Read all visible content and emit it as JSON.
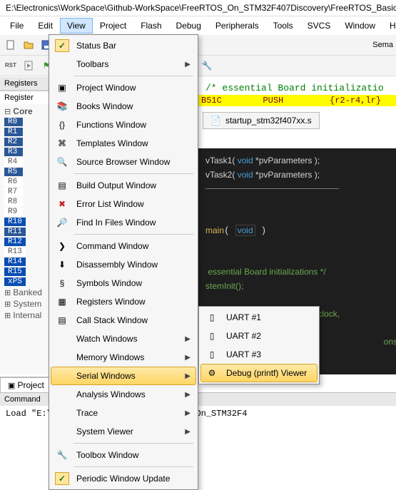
{
  "window_title": "E:\\Electronics\\WorkSpace\\Github-WorkSpace\\FreeRTOS_On_STM32F407Discovery\\FreeRTOS_Basic_Setup",
  "menubar": [
    "File",
    "Edit",
    "View",
    "Project",
    "Flash",
    "Debug",
    "Peripherals",
    "Tools",
    "SVCS",
    "Window",
    "Help"
  ],
  "sema_label": "Sema",
  "registers": {
    "panel_title": "Registers",
    "tab": "Register",
    "core_label": "Core",
    "regs": [
      "R0",
      "R1",
      "R2",
      "R3",
      "R4",
      "R5",
      "R6",
      "R7",
      "R8",
      "R9",
      "R10",
      "R11",
      "R12",
      "R13",
      "R14",
      "R15",
      "xPS"
    ],
    "groups": [
      "Banked",
      "System",
      "Internal"
    ],
    "project_tab": "Project"
  },
  "view_menu": {
    "status_bar": "Status Bar",
    "toolbars": "Toolbars",
    "project_window": "Project Window",
    "books_window": "Books Window",
    "functions_window": "Functions Window",
    "templates_window": "Templates Window",
    "source_browser_window": "Source Browser Window",
    "build_output_window": "Build Output Window",
    "error_list_window": "Error List Window",
    "find_in_files_window": "Find In Files Window",
    "command_window": "Command Window",
    "disassembly_window": "Disassembly Window",
    "symbols_window": "Symbols Window",
    "registers_window": "Registers Window",
    "call_stack_window": "Call Stack Window",
    "watch_windows": "Watch Windows",
    "memory_windows": "Memory Windows",
    "serial_windows": "Serial Windows",
    "analysis_windows": "Analysis Windows",
    "trace": "Trace",
    "system_viewer": "System Viewer",
    "toolbox_window": "Toolbox Window",
    "periodic_window_update": "Periodic Window Update"
  },
  "serial_submenu": {
    "uart1": "UART #1",
    "uart2": "UART #2",
    "uart3": "UART #3",
    "debug_printf": "Debug (printf) Viewer"
  },
  "code": {
    "comment1": "/* essential Board initializatio",
    "highlight_line": "B51C        PUSH         {r2-r4,lr}",
    "file_tab": "startup_stm32f407xx.s",
    "line1a": "vTask1( ",
    "line1b": "void",
    "line1c": " *pvParameters );",
    "line2a": "vTask2( ",
    "line2b": "void",
    "line2c": " *pvParameters );",
    "main_fn": "main",
    "main_void": "void",
    "cm1": " essential Board initializations */",
    "cm2": "stemInit();",
    "cm3_pre": "                                ",
    "cm3": "the MCU clock,",
    "cm4": "onsole ). Thi"
  },
  "command": {
    "title": "Command",
    "text": "Load \"E:\\                                Github-WorkSpace\\\\FreeRTOS_On_STM32F4"
  },
  "colors": {
    "accent": "#2b5797",
    "highlight": "#ffd664"
  }
}
